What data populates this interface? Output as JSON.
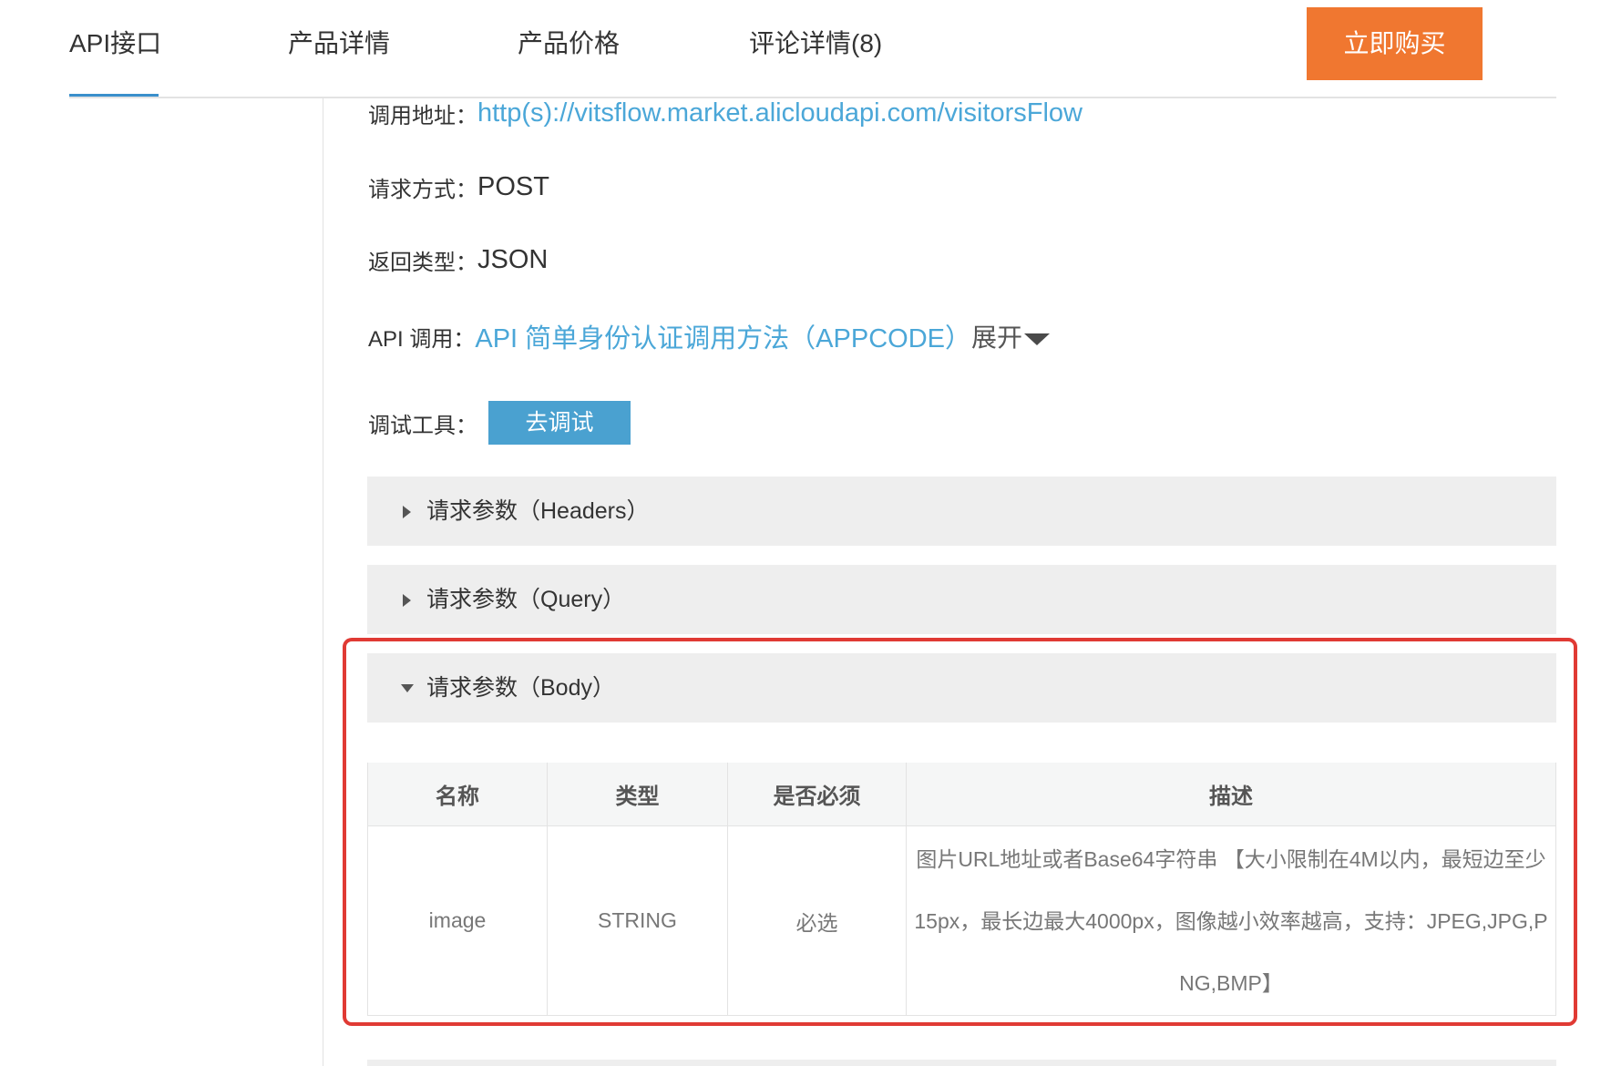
{
  "nav": {
    "tabs": [
      {
        "label": "API接口"
      },
      {
        "label": "产品详情"
      },
      {
        "label": "产品价格"
      },
      {
        "label": "评论详情(8)"
      }
    ],
    "buy_label": "立即购买"
  },
  "info": {
    "url_label": "调用地址：",
    "url_value": "http(s)://vitsflow.market.alicloudapi.com/visitorsFlow",
    "method_label": "请求方式：",
    "method_value": "POST",
    "return_label": "返回类型：",
    "return_value": "JSON",
    "call_label": "API 调用：",
    "call_link": "API 简单身份认证调用方法（APPCODE）",
    "expand_label": "展开",
    "debug_label": "调试工具：",
    "debug_button": "去调试"
  },
  "panels": [
    {
      "title": "请求参数（Headers）",
      "expanded": false
    },
    {
      "title": "请求参数（Query）",
      "expanded": false
    },
    {
      "title": "请求参数（Body）",
      "expanded": true
    }
  ],
  "body_table": {
    "headers": [
      "名称",
      "类型",
      "是否必须",
      "描述"
    ],
    "rows": [
      {
        "name": "image",
        "type": "STRING",
        "required": "必选",
        "description": "图片URL地址或者Base64字符串 【大小限制在4M以内，最短边至少15px，最长边最大4000px，图像越小效率越高，支持：JPEG,JPG,PNG,BMP】"
      }
    ]
  },
  "colors": {
    "accent": "#3a8fcb",
    "buy_button": "#f07730",
    "link": "#4ba7d8",
    "debug_button": "#4aa1d0",
    "highlight": "#e03a34"
  }
}
